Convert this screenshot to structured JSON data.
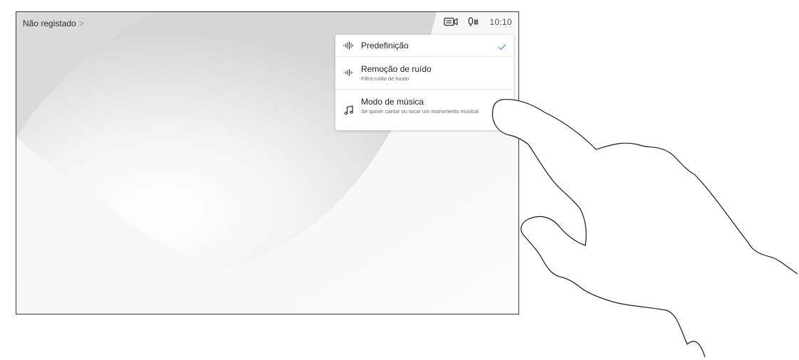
{
  "status_bar": {
    "registration_label": "Não registado",
    "registration_chevron": ">",
    "clock": "10:10",
    "icons": [
      "screen-share-icon",
      "microphone-settings-icon"
    ]
  },
  "audio_menu": {
    "items": [
      {
        "title": "Predefinição",
        "subtitle": "",
        "icon": "audio-wave-icon",
        "selected": true
      },
      {
        "title": "Remoção de ruído",
        "subtitle": "Filtra ruído de fundo",
        "icon": "audio-wave-small-icon",
        "selected": false
      },
      {
        "title": "Modo de música",
        "subtitle": "Se quiser cantar ou tocar um instrumento musical",
        "icon": "music-note-icon",
        "selected": false
      }
    ]
  },
  "colors": {
    "accent_check": "#4aa3d8",
    "wallpaper_light": "#f7f7f7",
    "wallpaper_shade": "#d9d9d9"
  }
}
